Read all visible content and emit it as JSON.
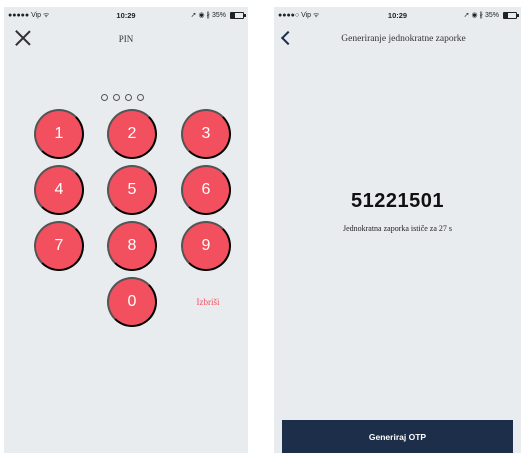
{
  "left_screen": {
    "status": {
      "carrier": "●●●●● Vip ᯤ",
      "time": "10:29",
      "indicators": "➚ ◉ ∦ 35%",
      "battery_pct": 35
    },
    "title": "PIN",
    "pin_dot_count": 4,
    "keys": [
      {
        "label": "1"
      },
      {
        "label": "2"
      },
      {
        "label": "3"
      },
      {
        "label": "4"
      },
      {
        "label": "5"
      },
      {
        "label": "6"
      },
      {
        "label": "7"
      },
      {
        "label": "8"
      },
      {
        "label": "9"
      },
      {
        "label": "0"
      }
    ],
    "delete_label": "Izbriši",
    "icons": {
      "close": "close-icon"
    },
    "colors": {
      "key": "#f2505f",
      "background": "#e9ecef"
    }
  },
  "right_screen": {
    "status": {
      "carrier": "●●●●○ Vip ᯤ",
      "time": "10:29",
      "indicators": "➚ ◉ ∦ 35%",
      "battery_pct": 35
    },
    "title": "Generiranje jednokratne zaporke",
    "otp_code": "51221501",
    "expiry_text": "Jednokratna zaporka ističe za 27 s",
    "generate_button": "Generiraj OTP",
    "icons": {
      "back": "chevron-left-icon"
    },
    "colors": {
      "button": "#1c2e4a"
    }
  }
}
